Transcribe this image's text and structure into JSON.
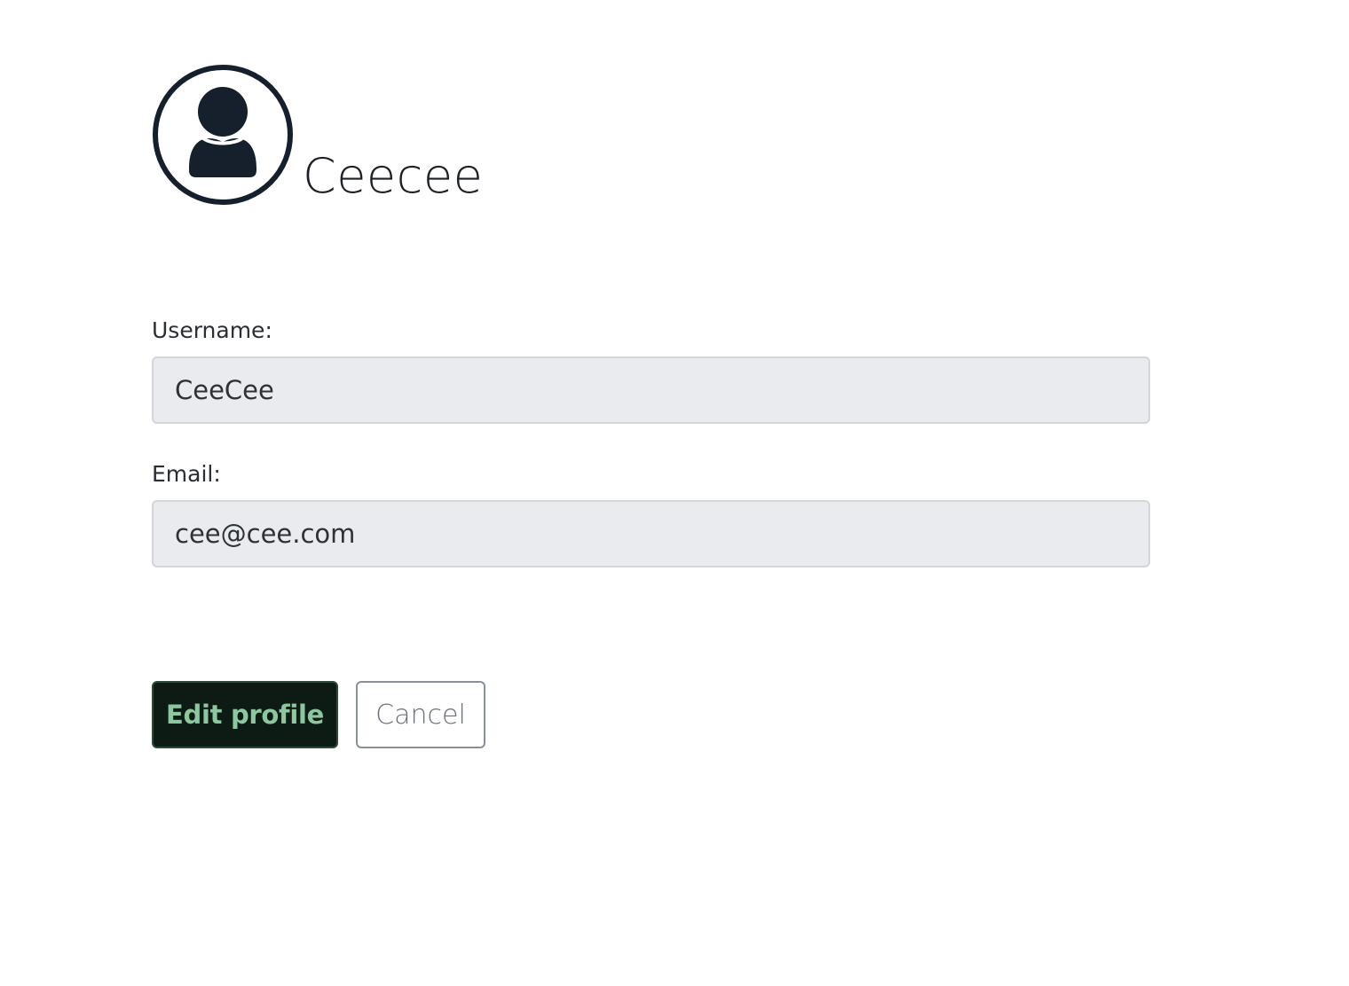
{
  "profile": {
    "display_name": "Ceecee",
    "avatar_icon": "user-circle-icon"
  },
  "form": {
    "username_label": "Username:",
    "username_value": "CeeCee",
    "email_label": "Email:",
    "email_value": "cee@cee.com"
  },
  "actions": {
    "edit_label": "Edit profile",
    "cancel_label": "Cancel"
  },
  "colors": {
    "avatar": "#16202c",
    "edit_button_bg": "#0e1b14",
    "edit_button_text": "#8cc7a0",
    "input_bg": "#e9ebee"
  }
}
